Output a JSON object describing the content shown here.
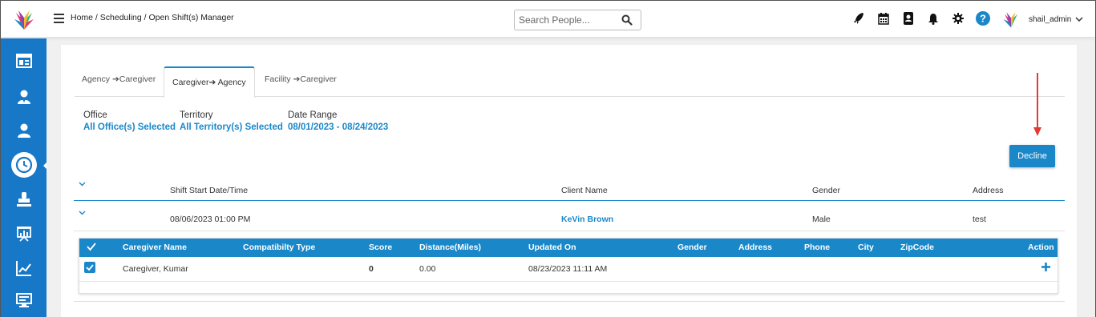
{
  "header": {
    "breadcrumb": "Home / Scheduling / Open Shift(s) Manager",
    "search_placeholder": "Search People...",
    "username": "shail_admin",
    "icons": [
      "rocket-icon",
      "calendar-icon",
      "contacts-icon",
      "bell-icon",
      "gear-icon",
      "help-icon"
    ]
  },
  "sidebar": {
    "items": [
      "dashboard-icon",
      "caregiver-icon",
      "client-icon",
      "clock-icon",
      "stamp-icon",
      "presentation-icon",
      "chart-icon",
      "monitor-icon"
    ],
    "active_index": 3
  },
  "tabs": [
    "Agency ➔Caregiver",
    "Caregiver➔ Agency",
    "Facility ➔Caregiver"
  ],
  "active_tab": 1,
  "filters": {
    "office_label": "Office",
    "office_value": "All Office(s) Selected",
    "territory_label": "Territory",
    "territory_value": "All Territory(s) Selected",
    "date_label": "Date Range",
    "date_value": "08/01/2023 - 08/24/2023"
  },
  "decline_label": "Decline",
  "table": {
    "headers": {
      "shift": "Shift Start Date/Time",
      "client": "Client Name",
      "gender": "Gender",
      "address": "Address"
    },
    "row": {
      "shift": "08/06/2023 01:00 PM",
      "client": "KeVin Brown",
      "gender": "Male",
      "address": "test"
    }
  },
  "subtable": {
    "headers": {
      "name": "Caregiver Name",
      "compat": "Compatibilty Type",
      "score": "Score",
      "distance": "Distance(Miles)",
      "updated": "Updated On",
      "gender": "Gender",
      "address": "Address",
      "phone": "Phone",
      "city": "City",
      "zip": "ZipCode",
      "action": "Action"
    },
    "row": {
      "name": "Caregiver, Kumar",
      "score": "0",
      "distance": "0.00",
      "updated": "08/23/2023 11:11 AM",
      "checked": true
    }
  },
  "colors": {
    "accent": "#1a87c9",
    "sidebar": "#1878c8",
    "annotation_arrow": "#e53935"
  }
}
